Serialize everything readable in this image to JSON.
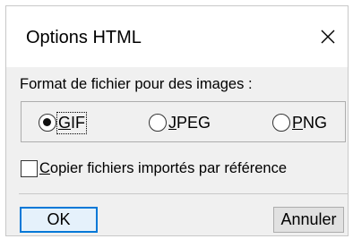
{
  "window": {
    "title": "Options HTML",
    "close_icon": "close-icon"
  },
  "image_format": {
    "label": "Format de fichier pour des images :",
    "options": [
      {
        "mnemonic": "G",
        "rest": "IF",
        "selected": true
      },
      {
        "mnemonic": "J",
        "rest": "PEG",
        "selected": false
      },
      {
        "mnemonic": "P",
        "rest": "NG",
        "selected": false
      }
    ]
  },
  "copy_option": {
    "mnemonic": "C",
    "rest": "opier fichiers importés par référence",
    "checked": false
  },
  "buttons": {
    "ok": "OK",
    "cancel": "Annuler"
  },
  "colors": {
    "focus_border": "#0078d7",
    "dialog_background": "#f0f0f0",
    "titlebar_background": "#ffffff"
  }
}
